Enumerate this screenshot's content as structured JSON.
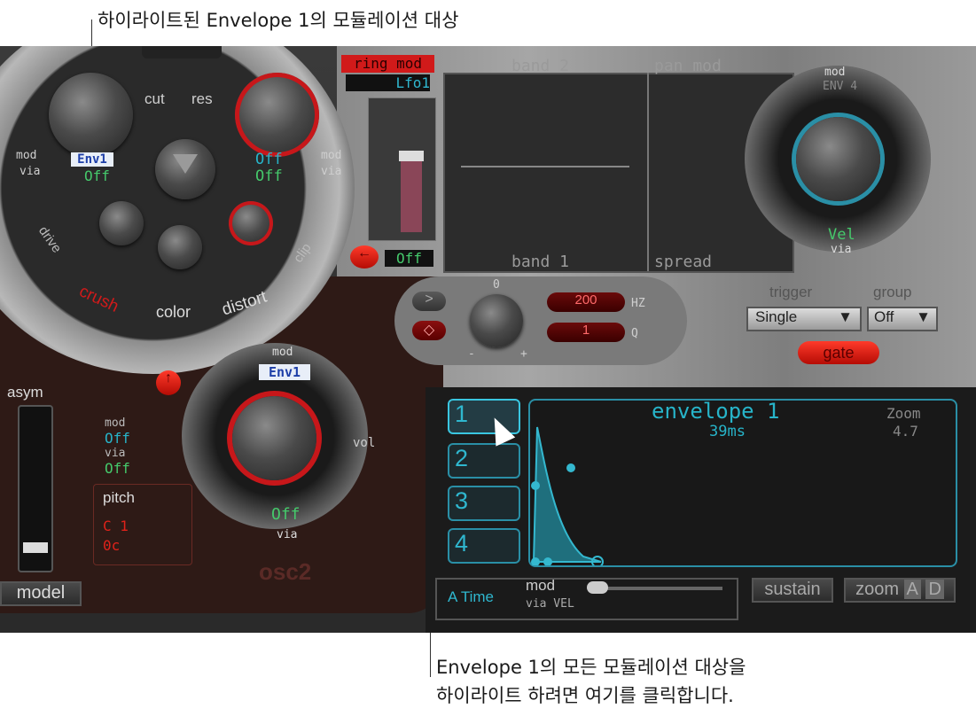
{
  "callouts": {
    "top": "하이라이트된 Envelope 1의 모듈레이션 대상",
    "bottom_line1": "Envelope 1의 모든 모듈레이션 대상을",
    "bottom_line2": "하이라이트 하려면 여기를 클릭합니다."
  },
  "filter": {
    "cut_label": "cut",
    "res_label": "res",
    "left_mod_label": "mod",
    "left_via_label": "via",
    "left_mod_value": "Env1",
    "left_via_value": "Off",
    "right_mod_value": "Off",
    "right_via_value": "Off",
    "right_mod_label": "mod",
    "right_via_label": "via",
    "drive_label": "drive",
    "clip_label": "clip",
    "crush_label": "crush",
    "color_label": "color",
    "distort_label": "distort"
  },
  "ring": {
    "title": "ring mod",
    "source": "Lfo1",
    "value": "Off"
  },
  "bands": {
    "band2": "band 2",
    "band1": "band 1",
    "pan_mod": "pan mod",
    "spread": "spread"
  },
  "pan_knob": {
    "mod_label": "mod",
    "mod_value": "ENV 4",
    "via_value": "Vel",
    "via_label": "via"
  },
  "eq": {
    "zero": "0",
    "minus": "-",
    "plus": "+",
    "freq_value": "200",
    "freq_unit": "HZ",
    "q_value": "1",
    "q_unit": "Q"
  },
  "trigger": {
    "label": "trigger",
    "value": "Single",
    "group_label": "group",
    "group_value": "Off",
    "gate_label": "gate"
  },
  "osc2": {
    "mod_label": "mod",
    "mod_value": "Env1",
    "vol_label": "vol",
    "via_value": "Off",
    "via_label": "via",
    "name": "osc2",
    "side_mod_label": "mod",
    "side_mod_value": "Off",
    "side_via_label": "via",
    "side_via_value": "Off",
    "pitch_label": "pitch",
    "pitch_note": "C 1",
    "pitch_cents": "0c"
  },
  "left_panel": {
    "asym_label": "asym",
    "model_label": "model"
  },
  "envelope": {
    "title": "envelope 1",
    "time": "39ms",
    "zoom_label": "Zoom",
    "zoom_value": "4.7",
    "buttons": [
      "1",
      "2",
      "3",
      "4"
    ],
    "selected": "1",
    "a_time": "A Time",
    "mod_label": "mod",
    "via_label": "via VEL",
    "sustain": "sustain",
    "zoom_btn": "zoom",
    "zoom_a": "A",
    "zoom_d": "D"
  },
  "colors": {
    "cyan": "#27b4c9",
    "green": "#45c96b",
    "red": "#d11a1a",
    "panel_dark": "#2e1a16"
  }
}
